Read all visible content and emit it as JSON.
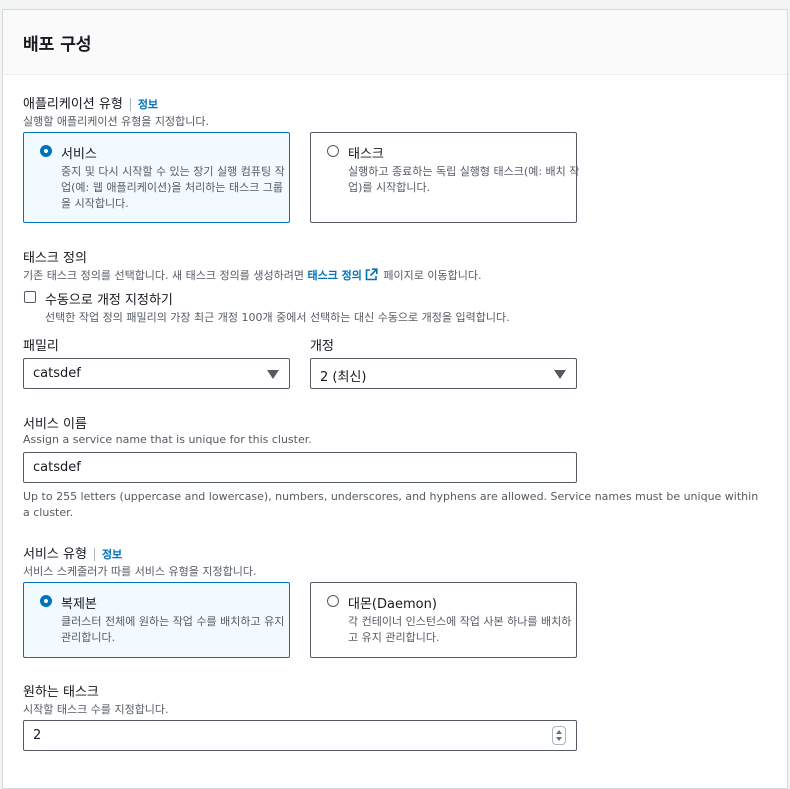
{
  "section_title": "배포 구성",
  "app_type": {
    "label": "애플리케이션 유형",
    "info": "정보",
    "description": "실행할 애플리케이션 유형을 지정합니다.",
    "options": [
      {
        "title": "서비스",
        "desc": "중지 및 다시 시작할 수 있는 장기 실행 컴퓨팅 작업(예: 웹 애플리케이션)을 처리하는 태스크 그룹을 시작합니다.",
        "selected": true
      },
      {
        "title": "태스크",
        "desc": "실행하고 종료하는 독립 실행형 태스크(예: 배치 작업)를 시작합니다.",
        "selected": false
      }
    ]
  },
  "task_definition": {
    "label": "태스크 정의",
    "desc_prefix": "기존 태스크 정의를 선택합니다. 새 태스크 정의를 생성하려면 ",
    "desc_link": "태스크 정의",
    "desc_suffix": " 페이지로 이동합니다.",
    "manual_checkbox_label": "수동으로 개정 지정하기",
    "manual_checkbox_desc": "선택한 작업 정의 패밀리의 가장 최근 개정 100개 중에서 선택하는 대신 수동으로 개정을 입력합니다.",
    "family_label": "패밀리",
    "family_value": "catsdef",
    "revision_label": "개정",
    "revision_value": "2 (최신)"
  },
  "service_name": {
    "label": "서비스 이름",
    "description": "Assign a service name that is unique for this cluster.",
    "value": "catsdef",
    "constraint": "Up to 255 letters (uppercase and lowercase), numbers, underscores, and hyphens are allowed. Service names must be unique within a cluster."
  },
  "service_type": {
    "label": "서비스 유형",
    "info": "정보",
    "description": "서비스 스케줄러가 따를 서비스 유형을 지정합니다.",
    "options": [
      {
        "title": "복제본",
        "desc": "클러스터 전체에 원하는 작업 수를 배치하고 유지 관리합니다.",
        "selected": true
      },
      {
        "title": "대몬(Daemon)",
        "desc": "각 컨테이너 인스턴스에 작업 사본 하나를 배치하고 유지 관리합니다.",
        "selected": false
      }
    ]
  },
  "desired_tasks": {
    "label": "원하는 태스크",
    "description": "시작할 태스크 수를 지정합니다.",
    "value": "2"
  },
  "colors": {
    "accent": "#0073bb",
    "text": "#16191f",
    "secondary_text": "#545b64",
    "selected_tile_bg": "#f1faff"
  }
}
